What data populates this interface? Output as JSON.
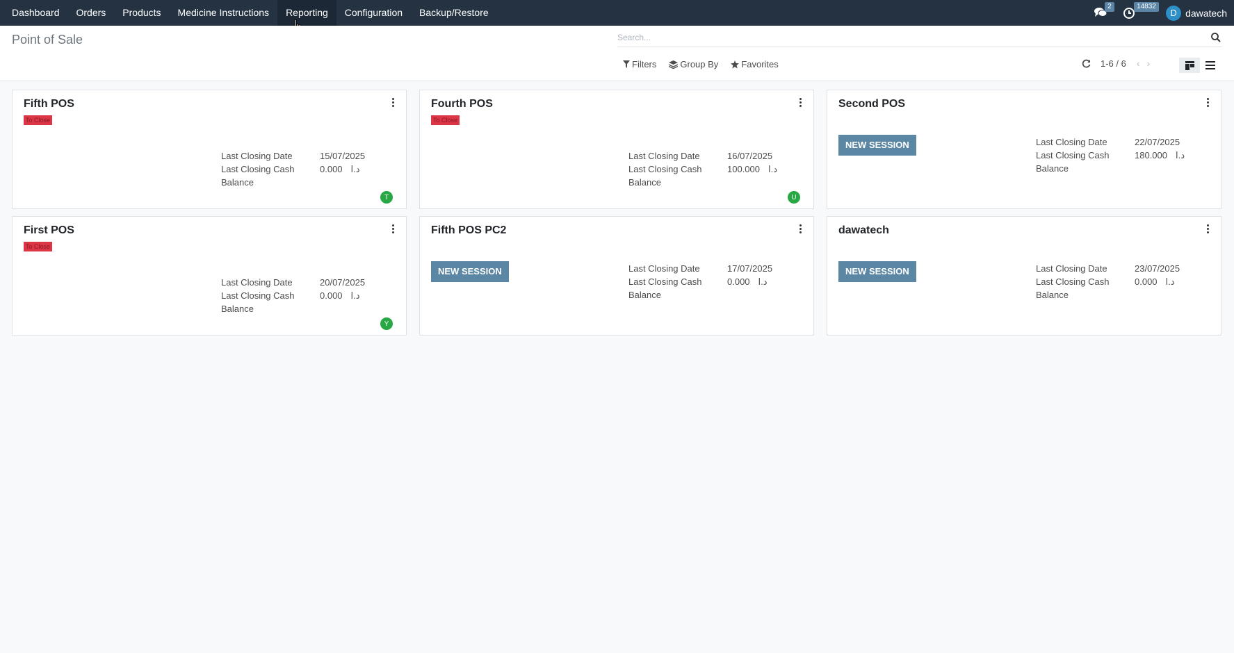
{
  "nav": {
    "items": [
      "Dashboard",
      "Orders",
      "Products",
      "Medicine Instructions",
      "Reporting",
      "Configuration",
      "Backup/Restore"
    ],
    "messages_badge": "2",
    "activities_badge": "14832",
    "user_initial": "D",
    "user_name": "dawatech"
  },
  "control_panel": {
    "title": "Point of Sale",
    "search_placeholder": "Search...",
    "filters": "Filters",
    "group_by": "Group By",
    "favorites": "Favorites",
    "pager_value": "1-6 / 6"
  },
  "cards": [
    {
      "name": "Fifth POS",
      "status": "To Close",
      "button": "",
      "date_label": "Last Closing Date",
      "date": "15/07/2025",
      "cash_label": "Last Closing Cash",
      "cash": "0.000",
      "currency": "د.ا",
      "balance_label": "Balance",
      "user_initial": "T"
    },
    {
      "name": "Fourth POS",
      "status": "To Close",
      "button": "",
      "date_label": "Last Closing Date",
      "date": "16/07/2025",
      "cash_label": "Last Closing Cash",
      "cash": "100.000",
      "currency": "د.ا",
      "balance_label": "Balance",
      "user_initial": "U"
    },
    {
      "name": "Second POS",
      "status": "",
      "button": "NEW SESSION",
      "date_label": "Last Closing Date",
      "date": "22/07/2025",
      "cash_label": "Last Closing Cash",
      "cash": "180.000",
      "currency": "د.ا",
      "balance_label": "Balance",
      "user_initial": ""
    },
    {
      "name": "First POS",
      "status": "To Close",
      "button": "",
      "date_label": "Last Closing Date",
      "date": "20/07/2025",
      "cash_label": "Last Closing Cash",
      "cash": "0.000",
      "currency": "د.ا",
      "balance_label": "Balance",
      "user_initial": "Y"
    },
    {
      "name": "Fifth POS PC2",
      "status": "",
      "button": "NEW SESSION",
      "date_label": "Last Closing Date",
      "date": "17/07/2025",
      "cash_label": "Last Closing Cash",
      "cash": "0.000",
      "currency": "د.ا",
      "balance_label": "Balance",
      "user_initial": ""
    },
    {
      "name": "dawatech",
      "status": "",
      "button": "NEW SESSION",
      "date_label": "Last Closing Date",
      "date": "23/07/2025",
      "cash_label": "Last Closing Cash",
      "cash": "0.000",
      "currency": "د.ا",
      "balance_label": "Balance",
      "user_initial": ""
    }
  ]
}
